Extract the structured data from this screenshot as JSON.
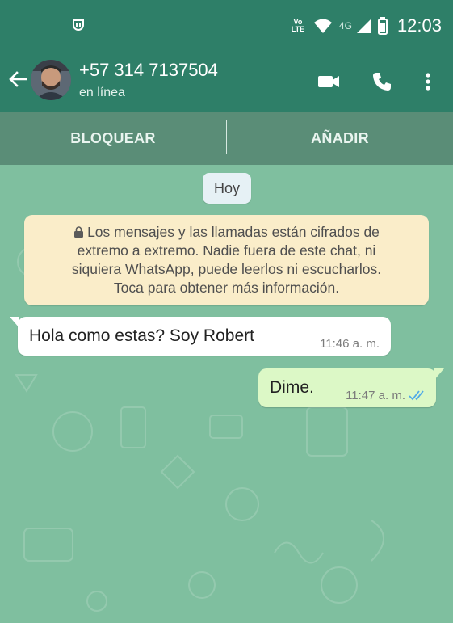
{
  "statusbar": {
    "left_icon": "mi-notification-icon",
    "volte_top": "Vo",
    "volte_bottom": "LTE",
    "network": "4G",
    "time": "12:03",
    "icons": [
      "wifi-icon",
      "signal-icon",
      "battery-icon"
    ]
  },
  "header": {
    "contact_name": "+57 314 7137504",
    "contact_status": "en línea",
    "icons": [
      "back-arrow-icon",
      "video-call-icon",
      "phone-icon",
      "more-vert-icon"
    ]
  },
  "actions": {
    "block_label": "BLOQUEAR",
    "add_label": "AÑADIR"
  },
  "chat": {
    "date_chip": "Hoy",
    "encryption_notice": {
      "line1": "Los mensajes y las llamadas están cifrados de",
      "line2": "extremo a extremo. Nadie fuera de este chat, ni",
      "line3": "siquiera WhatsApp, puede leerlos ni escucharlos.",
      "line4": "Toca para obtener más información."
    },
    "messages": [
      {
        "direction": "incoming",
        "text": "Hola como estas? Soy Robert",
        "time": "11:46 a. m."
      },
      {
        "direction": "outgoing",
        "text": "Dime.",
        "time": "11:47 a. m.",
        "status": "read"
      }
    ]
  },
  "colors": {
    "header_bg": "#2e7f68",
    "chat_bg": "#7fbf9f",
    "outgoing_bubble": "#dcf8c6",
    "notice_bg": "#faedc9",
    "read_tick": "#4fa9e8"
  }
}
